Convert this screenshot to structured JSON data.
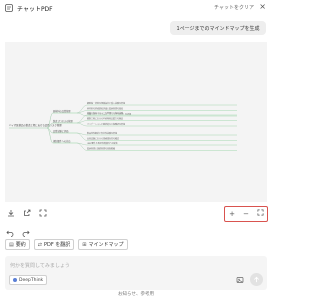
{
  "header": {
    "title": "チャットPDF",
    "clear_label": "チャットをクリア",
    "close_glyph": "×"
  },
  "chat": {
    "user_message": "1ページまでのマインドマップを生成"
  },
  "mindmap": {
    "root_label": "バイオ医薬品の製造工程における品質リスク管理",
    "branch_labels": [
      "原材料の品質管理",
      "製造プロセスの管理",
      "品質試験と評価",
      "規制要件への対応"
    ],
    "leaf_labels": [
      "細胞株・培地の規格設定と受入試験の実施",
      "原材料の供給業者評価と変更管理の徹底",
      "汚染リスク（ウイルス・マイコプラズマ）の評価",
      "培養工程のパラメータ管理と工程内試験",
      "精製工程における不純物除去能力の検証",
      "バリデーションと継続的な工程確認の実施",
      "製品特性解析と安定性試験の実施",
      "出荷試験における規格適合性の確認",
      "GMP要件と承認申請資料への反映",
      "変更管理と逸脱管理の体制整備"
    ],
    "node_color": "#8fd19e",
    "line_color": "#9cc9a8"
  },
  "toolbar": {
    "download_icon": "download-icon",
    "share_icon": "share-icon",
    "expand_icon": "expand-icon"
  },
  "zoom": {
    "plus": "+",
    "minus": "−",
    "fit": "⛶"
  },
  "actions": {
    "summary_label": "要約",
    "translate_label": "PDF を翻訳",
    "mindmap_label": "マインドマップ"
  },
  "input": {
    "placeholder": "何かを質問してみましょう",
    "deepthink_label": "DeepThink"
  },
  "footer": {
    "text": "お知らせ、参考用"
  }
}
